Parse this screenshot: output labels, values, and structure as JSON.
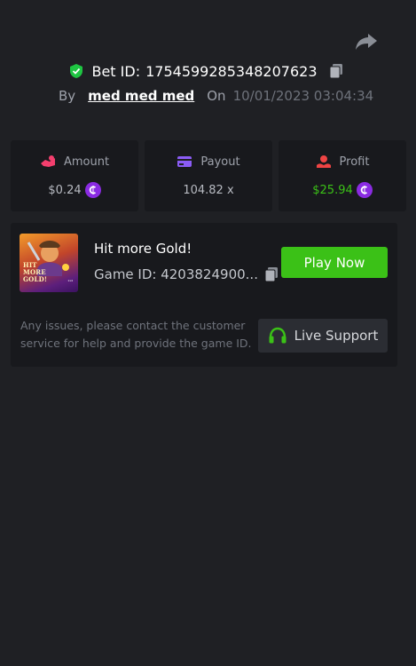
{
  "bet": {
    "label": "Bet ID:",
    "id": "1754599285348207623",
    "by_label": "By",
    "user": "med med med",
    "on_label": "On",
    "datetime": "10/01/2023 03:04:34"
  },
  "stats": [
    {
      "label": "Amount",
      "value": "$0.24",
      "icon": "amount-icon",
      "coin": true,
      "color": "#b7bac1"
    },
    {
      "label": "Payout",
      "value": "104.82 x",
      "icon": "payout-icon",
      "coin": false,
      "color": "#b7bac1"
    },
    {
      "label": "Profit",
      "value": "$25.94",
      "icon": "profit-icon",
      "coin": true,
      "color": "#3bc117"
    }
  ],
  "game": {
    "title": "Hit more Gold!",
    "id_label": "Game ID: 4203824900...",
    "thumb_text": "HIT MORE GOLD!",
    "thumb_sub": "1x4",
    "play_label": "Play Now"
  },
  "support": {
    "notice": "Any issues, please contact the customer service for help and provide the game ID.",
    "button_label": "Live Support"
  },
  "colors": {
    "background": "#1f2024",
    "card": "#18191d",
    "accent_green": "#3bc117",
    "coin_purple": "#8a2be2",
    "shield_green": "#1ec542",
    "payout_purple": "#8b5cf6",
    "amount_pink": "#f43f6e",
    "profit_red": "#ef4444"
  }
}
